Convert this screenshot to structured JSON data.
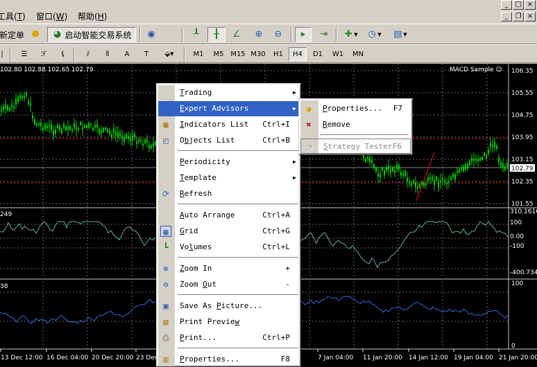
{
  "menubar": {
    "items": [
      {
        "label": "工具",
        "key": "T"
      },
      {
        "label": "窗口",
        "key": "W"
      },
      {
        "label": "帮助",
        "key": "H"
      }
    ]
  },
  "toolbar1": {
    "new_order": "新定单",
    "autotrade": "启动智能交易系统"
  },
  "toolbar2": {
    "timeframes": [
      "M1",
      "M5",
      "M15",
      "M30",
      "H1",
      "H4",
      "D1",
      "W1",
      "MN"
    ],
    "active_timeframe": "H4"
  },
  "chart": {
    "ohlc_header": "102.80 102.88 102.65 102.79",
    "expert_label": "MACD Sample",
    "price_scale": [
      "106.35",
      "105.55",
      "104.75",
      "103.95",
      "103.15",
      "102.35",
      "101.55"
    ],
    "current_price": "102.79",
    "indicator1_label": "249",
    "indicator1_scale": [
      "310.1616",
      "100",
      "0.00",
      "-100",
      "-400.734"
    ],
    "indicator2_label": "38",
    "indicator2_scale": [
      "100",
      "0"
    ],
    "time_axis": [
      "13 Dec 12:00",
      "16 Dec 04:00",
      "20 Dec 20:00",
      "23 Dec",
      "7 Jan 04:00",
      "11 Jan 20:00",
      "14 Jan 12:00",
      "19 Jan 04:00",
      "21 Jan 20:00"
    ],
    "colors": {
      "background": "#000000",
      "candles": "#00d000",
      "grid": "#6b6b6b",
      "levels": "#c02020",
      "cci_line": "#5fb3a6",
      "rsi_line": "#2f6cd8",
      "trend_line": "#d01010"
    }
  },
  "context_menu": {
    "items": [
      {
        "label": "Trading",
        "key": "T",
        "submenu": true
      },
      {
        "label": "Expert Advisors",
        "key": "E",
        "submenu": true,
        "highlighted": true
      },
      {
        "label": "Indicators List",
        "key": "I",
        "shortcut": "Ctrl+I",
        "icon": "indicators-icon"
      },
      {
        "label": "Objects List",
        "key": "b",
        "shortcut": "Ctrl+B",
        "icon": "objects-icon"
      },
      {
        "label": "Periodicity",
        "key": "P",
        "submenu": true
      },
      {
        "label": "Template",
        "key": "T",
        "submenu": true
      },
      {
        "label": "Refresh",
        "key": "R",
        "icon": "refresh-icon"
      },
      {
        "label": "Auto Arrange",
        "key": "A",
        "shortcut": "Ctrl+A"
      },
      {
        "label": "Grid",
        "key": "G",
        "shortcut": "Ctrl+G",
        "icon": "grid-icon"
      },
      {
        "label": "Volumes",
        "key": "l",
        "shortcut": "Ctrl+L",
        "icon": "volumes-icon"
      },
      {
        "label": "Zoom In",
        "key": "Z",
        "shortcut": "+",
        "icon": "zoom-in-icon"
      },
      {
        "label": "Zoom Out",
        "key": "O",
        "shortcut": "-",
        "icon": "zoom-out-icon"
      },
      {
        "label": "Save As Picture...",
        "key": "P",
        "icon": "save-picture-icon"
      },
      {
        "label": "Print Preview",
        "key": "w",
        "icon": "print-preview-icon"
      },
      {
        "label": "Print...",
        "key": "P",
        "shortcut": "Ctrl+P",
        "icon": "print-icon"
      },
      {
        "label": "Properties...",
        "key": "P",
        "shortcut": "F8",
        "icon": "properties-icon"
      }
    ]
  },
  "submenu": {
    "items": [
      {
        "label": "Properties...",
        "key": "P",
        "shortcut": "F7",
        "icon": "expert-properties-icon"
      },
      {
        "label": "Remove",
        "key": "R",
        "icon": "expert-remove-icon"
      },
      {
        "label": "Strategy Tester",
        "key": "S",
        "shortcut": "F6",
        "icon": "strategy-tester-icon",
        "disabled": true
      }
    ]
  }
}
